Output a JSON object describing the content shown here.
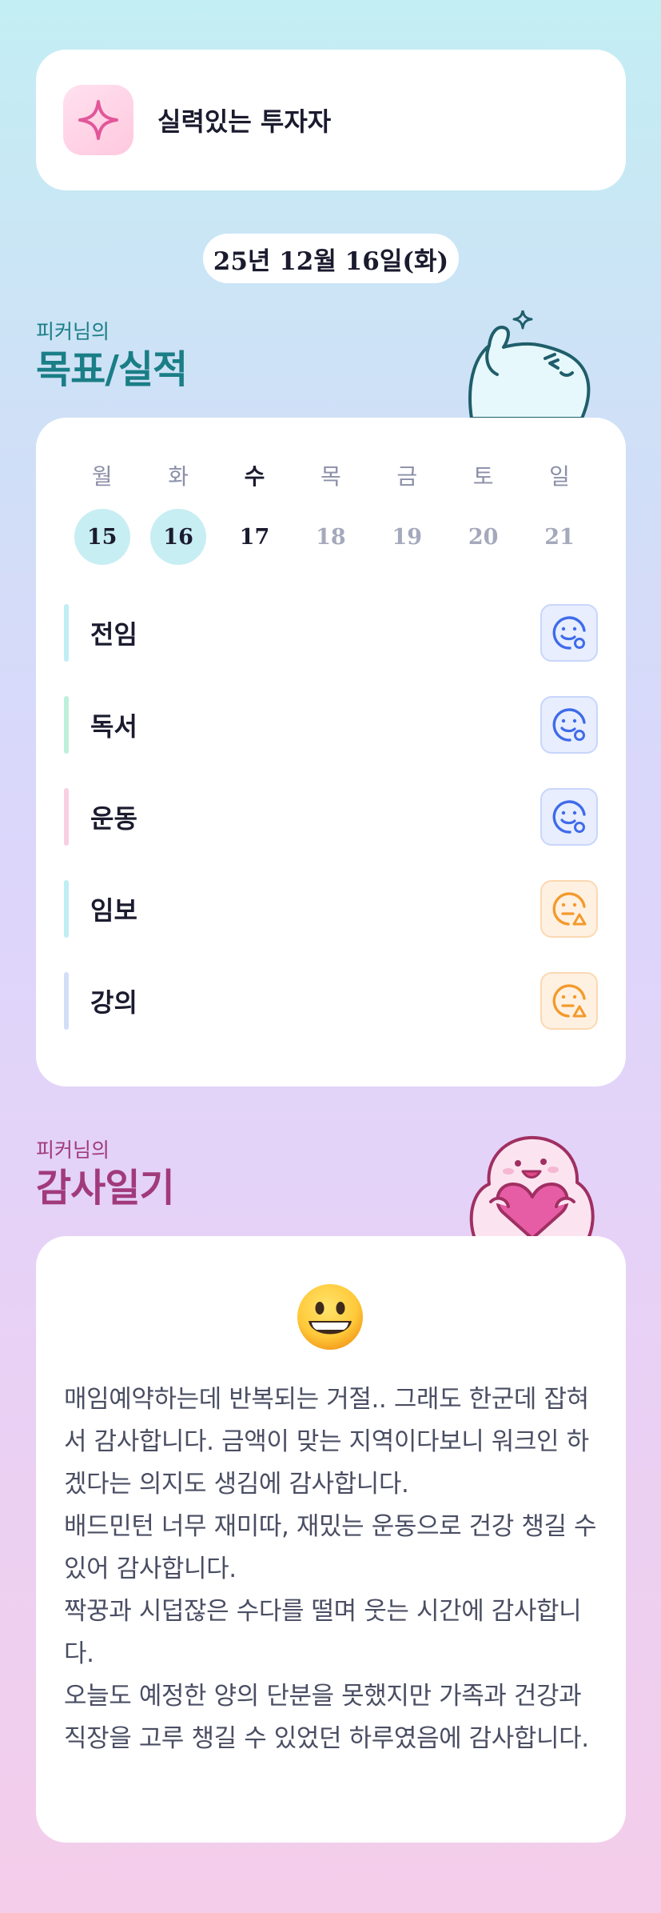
{
  "profile": {
    "title": "실력있는 투자자",
    "icon": "sparkle-icon"
  },
  "date": {
    "label": "25년 12월 16일(화)"
  },
  "goals_section": {
    "subtitle": "피커님의",
    "title": "목표/실적",
    "weekdays": [
      "월",
      "화",
      "수",
      "목",
      "금",
      "토",
      "일"
    ],
    "dates": [
      "15",
      "16",
      "17",
      "18",
      "19",
      "20",
      "21"
    ],
    "items": [
      {
        "label": "전임",
        "status": "smile-done",
        "bar_color": "#bfeef4"
      },
      {
        "label": "독서",
        "status": "smile-done",
        "bar_color": "#bdf0dc"
      },
      {
        "label": "운동",
        "status": "smile-done",
        "bar_color": "#f9cfe2"
      },
      {
        "label": "임보",
        "status": "meh-warning",
        "bar_color": "#bfeef4"
      },
      {
        "label": "강의",
        "status": "meh-warning",
        "bar_color": "#d2def8"
      }
    ]
  },
  "thanks_section": {
    "subtitle": "피커님의",
    "title": "감사일기",
    "emoji": "grinning-face-icon",
    "text": "매임예약하는데 반복되는 거절.. 그래도 한군데 잡혀서 감사합니다. 금액이 맞는 지역이다보니 워크인 하겠다는 의지도 생김에 감사합니다.\n배드민턴 너무 재미따, 재밌는 운동으로 건강 챙길 수 있어 감사합니다.\n짝꿍과 시덥잖은 수다를 떨며 웃는 시간에 감사합니다.\n오늘도 예정한 양의 단분을 못했지만 가족과 건강과 직장을 고루 챙길 수 있었던 하루였음에 감사합니다."
  },
  "colors": {
    "goal_accent": "#1a7e86",
    "thanks_accent": "#a13a7b",
    "done_circle": "#c7eef3",
    "status_good": "#3f6bea",
    "status_warn": "#f39a2c"
  }
}
